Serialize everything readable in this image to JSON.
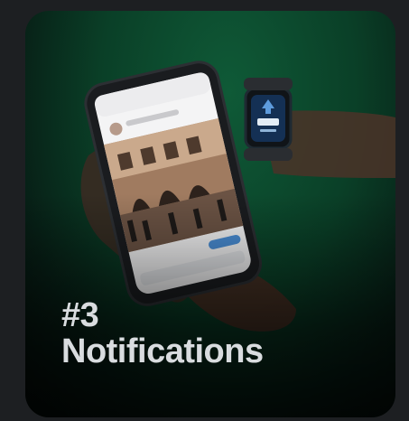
{
  "card": {
    "number": "#3",
    "title": "Notifications"
  },
  "colors": {
    "page_background": "#1d1f22",
    "card_green": "#0a3f27",
    "title_text": "#d9dcdf",
    "phone_button": "#4a8ed6",
    "watch_screen": "#3a78c0"
  },
  "icons": {
    "photo": "phone-photo",
    "watch": "smartwatch-icon"
  }
}
